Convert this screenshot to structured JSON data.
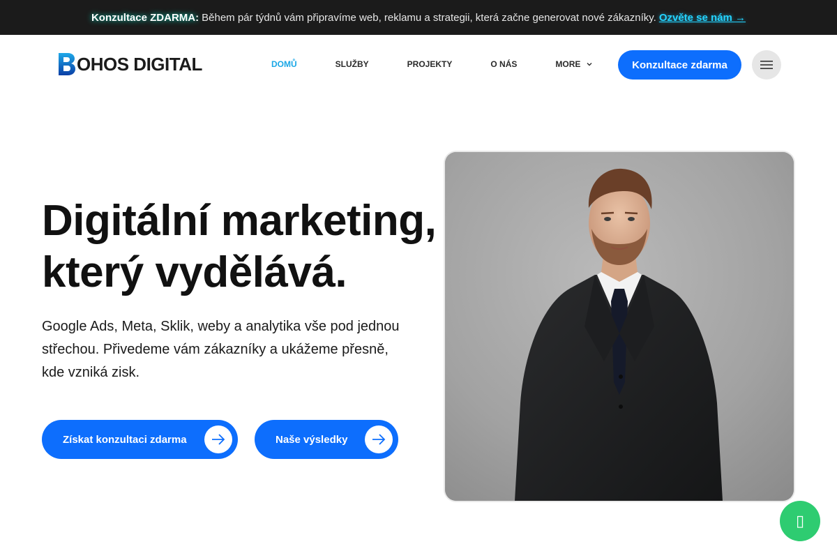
{
  "topbar": {
    "strong": "Konzultace ZDARMA:",
    "message": "Během pár týdnů vám připravíme web, reklamu a strategii, která začne generovat nové zákazníky.",
    "cta": "Ozvěte se nám →"
  },
  "header": {
    "logo_letter": "B",
    "logo_text": "OHOS DIGITAL",
    "nav": [
      {
        "label": "DOMŮ",
        "active": true
      },
      {
        "label": "SLUŽBY"
      },
      {
        "label": "PROJEKTY"
      },
      {
        "label": "O NÁS"
      },
      {
        "label": "MORE"
      }
    ],
    "cta": "Konzultace zdarma"
  },
  "hero": {
    "title_line1": "Digitální marketing,",
    "title_line2": "který vydělává.",
    "subtitle": "Google Ads, Meta, Sklik, weby a analytika vše pod jednou střechou. Přivedeme vám zákazníky a ukážeme přesně, kde vzniká zisk.",
    "primary_button": "Získat konzultaci zdarma",
    "secondary_button": "Naše výsledky"
  },
  "colors": {
    "accent": "#0d6efd",
    "nav_active": "#1aa7e6",
    "topbar_bg": "#1b1b1b",
    "chat": "#2ecc71"
  },
  "icons": {
    "menu": "hamburger-icon",
    "arrow": "arrow-right-icon",
    "chat": "chat-icon",
    "more": "chevron-down-icon"
  }
}
